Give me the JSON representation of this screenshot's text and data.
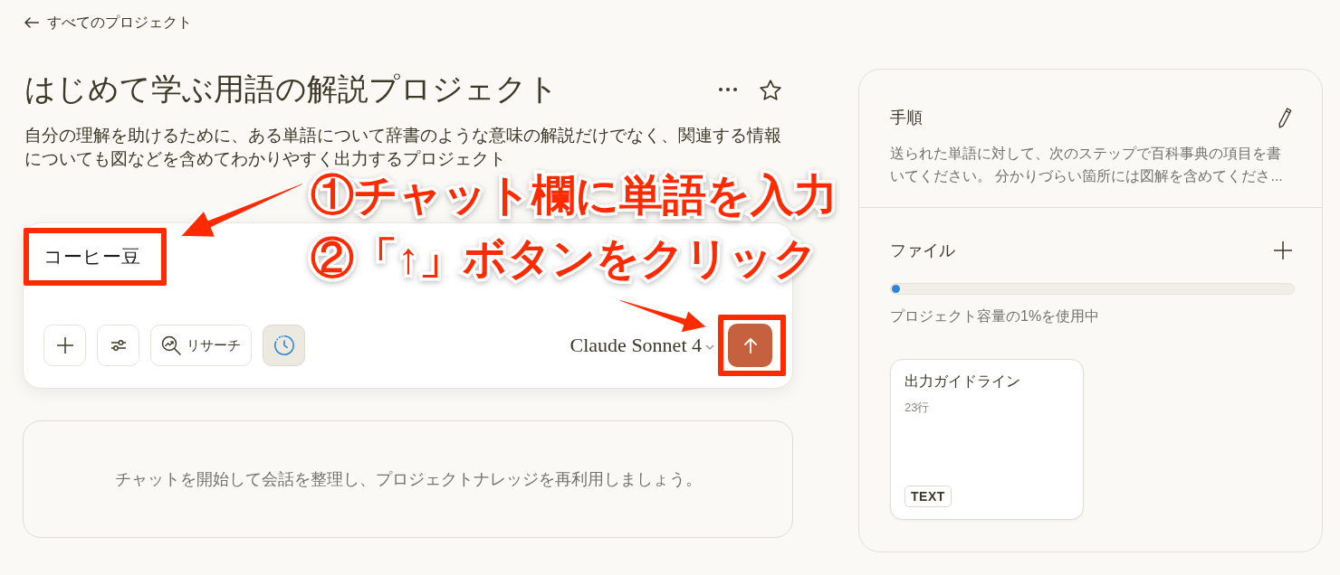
{
  "back_link": {
    "label": "すべてのプロジェクト"
  },
  "project": {
    "title": "はじめて学ぶ用語の解説プロジェクト",
    "description": "自分の理解を助けるために、ある単語について辞書のような意味の解説だけでなく、関連する情報についても図などを含めてわかりやすく出力するプロジェクト"
  },
  "composer": {
    "value": "コーヒー豆",
    "tools": [
      {
        "kind": "add",
        "on": false
      },
      {
        "kind": "settings",
        "on": false
      },
      {
        "kind": "research",
        "label": "リサーチ",
        "on": false
      },
      {
        "kind": "clock",
        "on": true
      }
    ],
    "model": "Claude Sonnet 4"
  },
  "empty_state": {
    "message": "チャットを開始して会話を整理し、プロジェクトナレッジを再利用しましょう。"
  },
  "instructions": {
    "heading": "手順",
    "text": "送られた単語に対して、次のステップで百科事典の項目を書いてください。 分かりづらい箇所には図解を含めてくださ..."
  },
  "files": {
    "heading": "ファイル",
    "usage": {
      "level": 0.01,
      "label": "プロジェクト容量の1%を使用中"
    },
    "items": [
      {
        "name": "出力ガイドライン",
        "meta": "23行",
        "type": "TEXT"
      }
    ]
  },
  "annotations": [
    {
      "text": "①チャット欄に単語を入力"
    },
    {
      "text": "②「↑」ボタンをクリック"
    }
  ]
}
